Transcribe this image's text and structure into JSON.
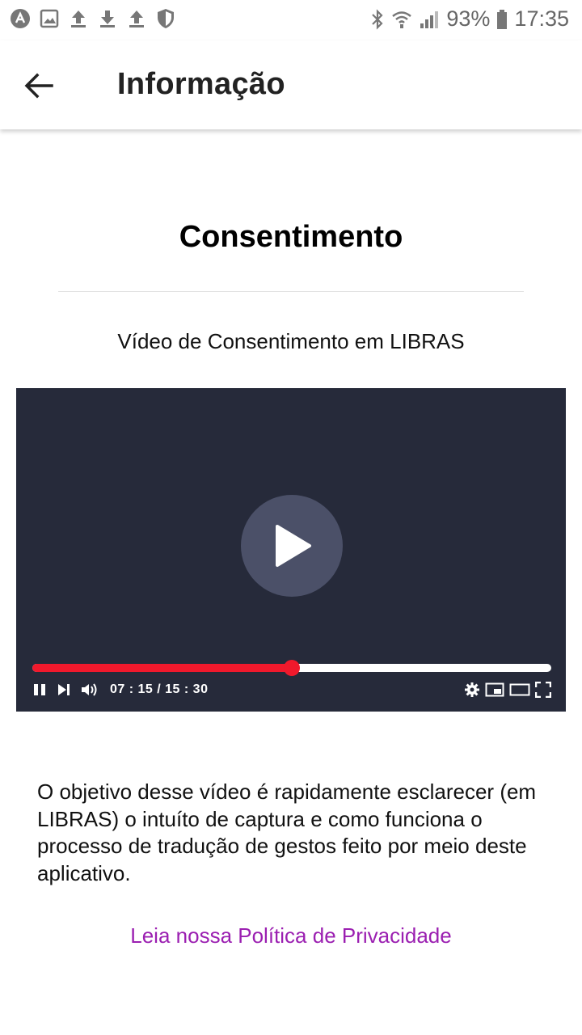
{
  "status_bar": {
    "battery": "93%",
    "time": "17:35",
    "left_icons": [
      "app-icon",
      "image-icon",
      "upload-icon",
      "download-icon",
      "upload-icon",
      "shield-icon"
    ],
    "right_icons": [
      "bluetooth-icon",
      "wifi-icon",
      "signal-icon",
      "battery-icon"
    ]
  },
  "app_bar": {
    "title": "Informação",
    "back_icon": "arrow-left-icon"
  },
  "content": {
    "heading": "Consentimento",
    "video_caption": "Vídeo de Consentimento em LIBRAS",
    "description": "O objetivo desse vídeo é rapidamente esclarecer (em LIBRAS) o intuíto de captura e como funciona o processo de tradução de gestos feito por meio deste aplicativo.",
    "privacy_link": "Leia nossa Política de Privacidade"
  },
  "video_player": {
    "time_display": "07 : 15 / 15 : 30",
    "progress_fraction": 0.5,
    "icons": [
      "play-icon",
      "pause-icon",
      "skip-next-icon",
      "volume-icon",
      "settings-icon",
      "miniplayer-icon",
      "theater-icon",
      "fullscreen-icon"
    ]
  },
  "colors": {
    "player_bg": "#262a3a",
    "progress_played": "#f0192c",
    "progress_rest": "#ffffff",
    "link": "#9b1fb1"
  }
}
